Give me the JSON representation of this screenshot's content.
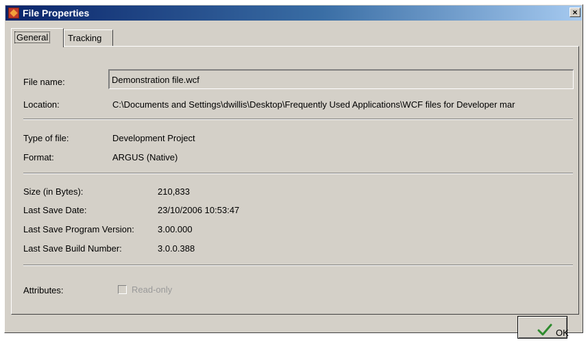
{
  "window": {
    "title": "File Properties",
    "close_glyph": "×",
    "icon": "app-icon"
  },
  "tabs": [
    {
      "label": "General",
      "active": true
    },
    {
      "label": "Tracking",
      "active": false
    }
  ],
  "general": {
    "file_name_label": "File name:",
    "file_name_value": "Demonstration file.wcf",
    "location_label": "Location:",
    "location_value": "C:\\Documents and Settings\\dwillis\\Desktop\\Frequently Used Applications\\WCF files for Developer mar",
    "type_label": "Type of file:",
    "type_value": "Development Project",
    "format_label": "Format:",
    "format_value": "ARGUS (Native)",
    "size_label": "Size (in Bytes):",
    "size_value": "210,833",
    "save_date_label": "Last Save Date:",
    "save_date_value": "23/10/2006 10:53:47",
    "program_version_label": "Last Save Program Version:",
    "program_version_value": "3.00.000",
    "build_number_label": "Last Save Build Number:",
    "build_number_value": "3.0.0.388",
    "attributes_label": "Attributes:",
    "readonly_label": "Read-only",
    "readonly_checked": false,
    "readonly_enabled": false
  },
  "footer": {
    "ok_label": "OK",
    "ok_icon": "checkmark-icon",
    "ok_icon_color": "#2e8b2e"
  }
}
